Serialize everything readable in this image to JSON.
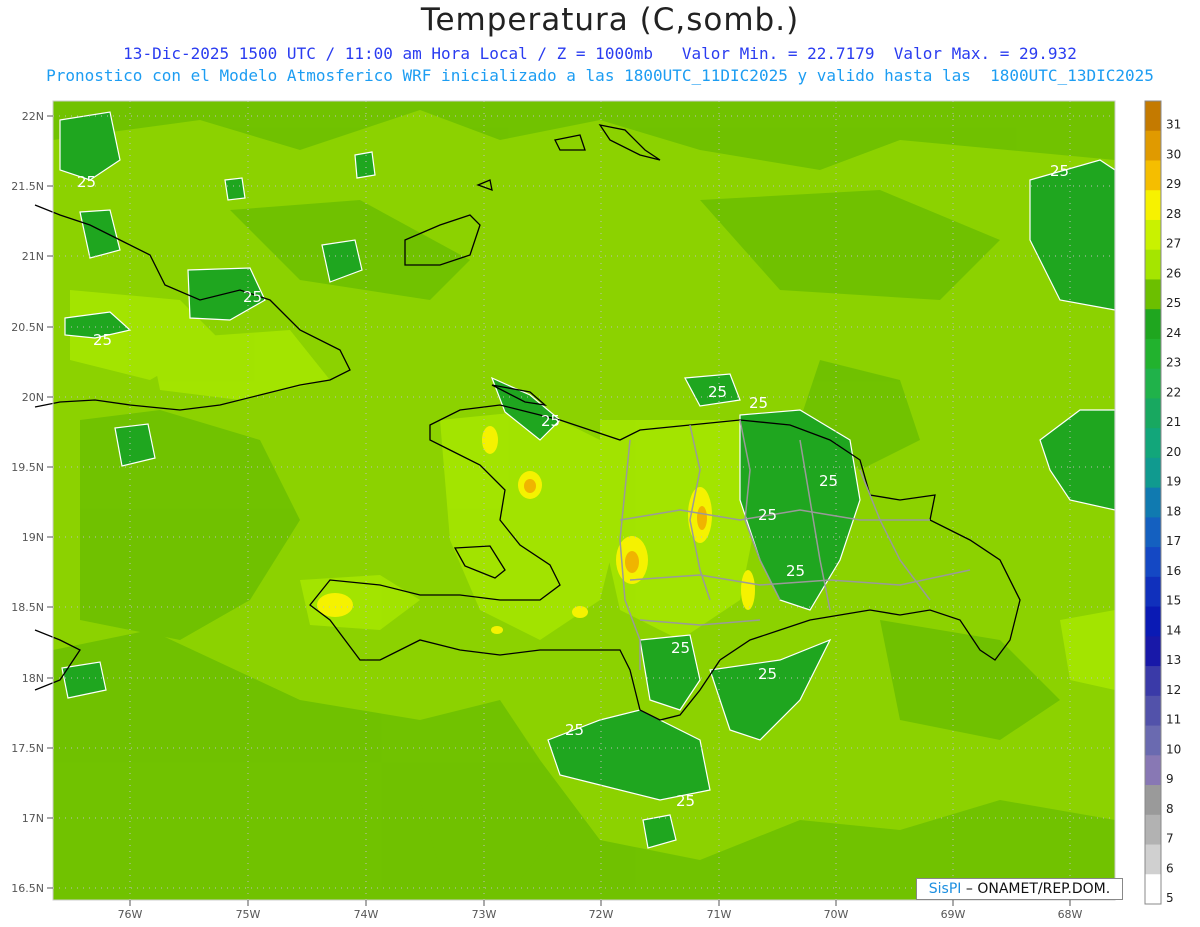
{
  "title": "Temperatura (C,somb.)",
  "subtitle_1": "13-Dic-2025 1500 UTC / 11:00 am Hora Local / Z = 1000mb   Valor Min. = 22.7179  Valor Max. = 29.932",
  "subtitle_2": "Pronostico con el Modelo Atmosferico WRF inicializado a las 1800UTC_11DIC2025 y valido hasta las  1800UTC_13DIC2025",
  "credit": {
    "brand": "SisPI",
    "rest": " – ONAMET/REP.DOM."
  },
  "axes": {
    "lat_labels": [
      "22N",
      "21.5N",
      "21N",
      "20.5N",
      "20N",
      "19.5N",
      "19N",
      "18.5N",
      "18N",
      "17.5N",
      "17N",
      "16.5N"
    ],
    "lon_labels": [
      "76W",
      "75W",
      "74W",
      "73W",
      "72W",
      "71W",
      "70W",
      "69W",
      "68W"
    ]
  },
  "contour_labels": [
    "25",
    "25",
    "25",
    "25",
    "25",
    "25",
    "25",
    "25",
    "25",
    "25",
    "25",
    "25",
    "25",
    "25",
    "25",
    "25"
  ],
  "colorbar": {
    "levels": [
      "31",
      "30",
      "29",
      "28",
      "27",
      "26",
      "25",
      "24",
      "23",
      "22",
      "21",
      "20",
      "19",
      "18",
      "17",
      "16",
      "15",
      "14",
      "13",
      "12",
      "11",
      "10",
      "9",
      "8",
      "7",
      "6",
      "5"
    ],
    "colors": [
      "#c47a00",
      "#e09a00",
      "#f5be00",
      "#f7f200",
      "#c9f200",
      "#a5e500",
      "#6cbf00",
      "#1fa61f",
      "#22b22e",
      "#20b24a",
      "#18a860",
      "#12a67a",
      "#109a8f",
      "#107ab0",
      "#1460c0",
      "#1448c4",
      "#1030bc",
      "#0a1ab4",
      "#1818a8",
      "#3a3aa8",
      "#5252aa",
      "#6a6ab0",
      "#8878b4",
      "#9a9a9a",
      "#b2b2b2",
      "#d0d0d0",
      "#ffffff"
    ]
  },
  "field_colors": {
    "base": "#8cd200",
    "light": "#a5e500",
    "dark": "#6cbf00",
    "green": "#1fa61f",
    "yellow": "#f5f200",
    "orange": "#f0b400"
  }
}
